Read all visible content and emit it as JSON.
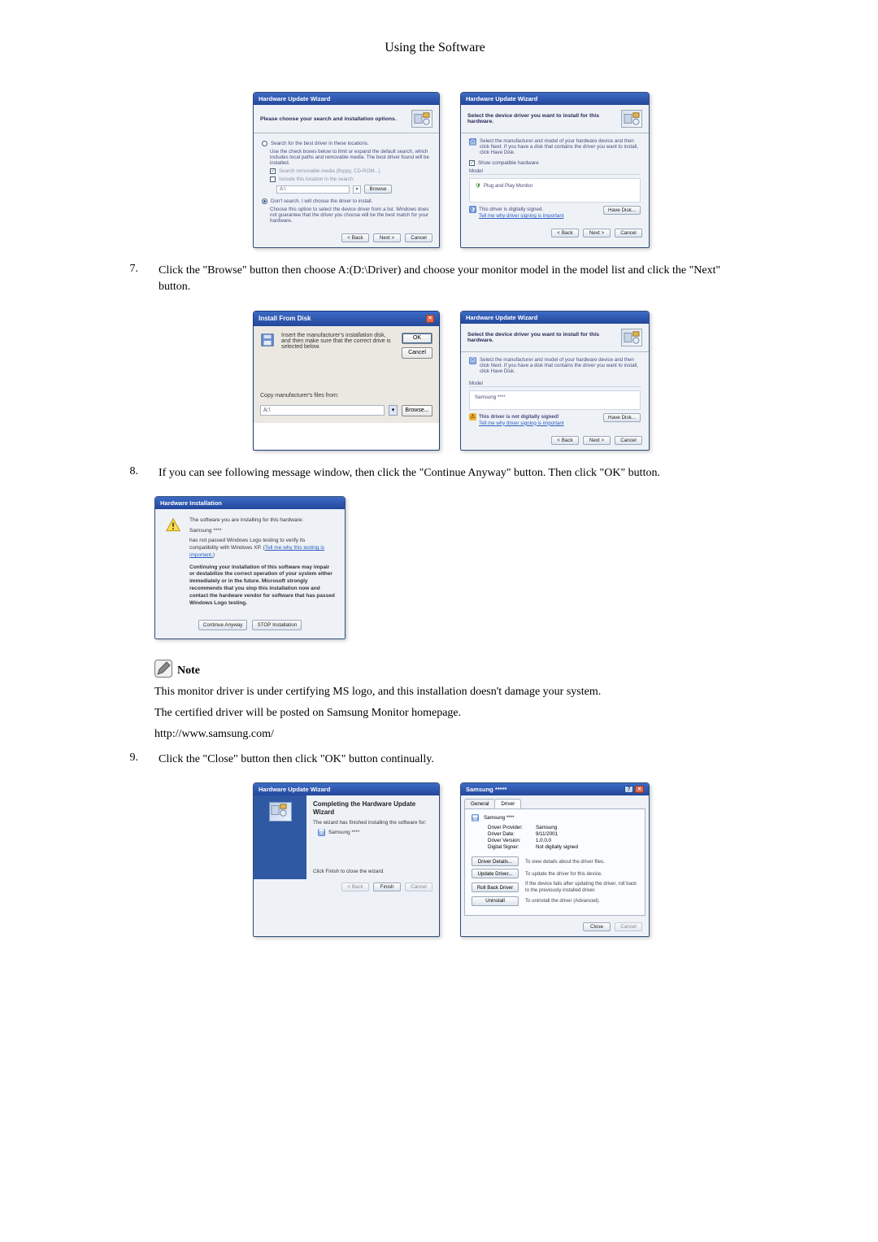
{
  "page_heading": "Using the Software",
  "steps": {
    "s7_num": "7.",
    "s7_text": "Click the \"Browse\" button then choose A:(D:\\Driver) and choose your monitor model in the model list and click the \"Next\" button.",
    "s8_num": "8.",
    "s8_text": "If you can see following message window, then click the \"Continue Anyway\" button. Then click \"OK\" button.",
    "s9_num": "9.",
    "s9_text": "Click the \"Close\" button then click \"OK\" button continually."
  },
  "note": {
    "label": "Note",
    "p1": "This monitor driver is under certifying MS logo, and this installation doesn't damage your system.",
    "p2": "The certified driver will be posted on Samsung Monitor homepage.",
    "p3": "http://www.samsung.com/"
  },
  "dlg1": {
    "title": "Hardware Update Wizard",
    "header": "Please choose your search and installation options.",
    "r1": "Search for the best driver in these locations.",
    "r1_desc": "Use the check boxes below to limit or expand the default search, which includes local paths and removable media. The best driver found will be installed.",
    "c1": "Search removable media (floppy, CD-ROM...)",
    "c2": "Include this location in the search:",
    "path": "A:\\",
    "browse": "Browse",
    "r2": "Don't search. I will choose the driver to install.",
    "r2_desc": "Choose this option to select the device driver from a list. Windows does not guarantee that the driver you choose will be the best match for your hardware.",
    "back": "< Back",
    "next": "Next >",
    "cancel": "Cancel"
  },
  "dlg2": {
    "title": "Hardware Update Wizard",
    "header": "Select the device driver you want to install for this hardware.",
    "sub": "Select the manufacturer and model of your hardware device and then click Next. If you have a disk that contains the driver you want to install, click Have Disk.",
    "show_compat": "Show compatible hardware",
    "model_lbl": "Model",
    "model_item": "Plug and Play Monitor",
    "signed": "This driver is digitally signed.",
    "tell": "Tell me why driver signing is important",
    "have_disk": "Have Disk...",
    "back": "< Back",
    "next": "Next >",
    "cancel": "Cancel"
  },
  "ifd": {
    "title": "Install From Disk",
    "msg": "Insert the manufacturer's installation disk, and then make sure that the correct drive is selected below.",
    "ok": "OK",
    "cancel": "Cancel",
    "copy_lbl": "Copy manufacturer's files from:",
    "path": "A:\\",
    "browse": "Browse..."
  },
  "dlg4": {
    "title": "Hardware Update Wizard",
    "header": "Select the device driver you want to install for this hardware.",
    "sub": "Select the manufacturer and model of your hardware device and then click Next. If you have a disk that contains the driver you want to install, click Have Disk.",
    "model_lbl": "Model",
    "model_item": "Samsung ****",
    "not_signed": "This driver is not digitally signed!",
    "tell": "Tell me why driver signing is important",
    "have_disk": "Have Disk...",
    "back": "< Back",
    "next": "Next >",
    "cancel": "Cancel"
  },
  "warn": {
    "title": "Hardware Installation",
    "l1": "The software you are installing for this hardware:",
    "l2": "Samsung ****",
    "l3a": "has not passed Windows Logo testing to verify its compatibility with Windows XP. (",
    "l3b": "Tell me why this testing is important.",
    "l3c": ")",
    "bold": "Continuing your installation of this software may impair or destabilize the correct operation of your system either immediately or in the future. Microsoft strongly recommends that you stop this installation now and contact the hardware vendor for software that has passed Windows Logo testing.",
    "btn_continue": "Continue Anyway",
    "btn_stop": "STOP Installation"
  },
  "cw": {
    "title": "Hardware Update Wizard",
    "h": "Completing the Hardware Update Wizard",
    "l1": "The wizard has finished installing the software for:",
    "l2": "Samsung ****",
    "l3": "Click Finish to close the wizard.",
    "back": "< Back",
    "finish": "Finish",
    "cancel": "Cancel"
  },
  "prop": {
    "title": "Samsung *****",
    "tab_general": "General",
    "tab_driver": "Driver",
    "name": "Samsung ****",
    "k_provider": "Driver Provider:",
    "v_provider": "Samsung",
    "k_date": "Driver Date:",
    "v_date": "9/11/2001",
    "k_version": "Driver Version:",
    "v_version": "1.0.0.0",
    "k_signer": "Digital Signer:",
    "v_signer": "Not digitally signed",
    "b_details": "Driver Details...",
    "d_details": "To view details about the driver files.",
    "b_update": "Update Driver...",
    "d_update": "To update the driver for this device.",
    "b_roll": "Roll Back Driver",
    "d_roll": "If the device fails after updating the driver, roll back to the previously installed driver.",
    "b_uninstall": "Uninstall",
    "d_uninstall": "To uninstall the driver (Advanced).",
    "close": "Close",
    "cancel": "Cancel"
  }
}
